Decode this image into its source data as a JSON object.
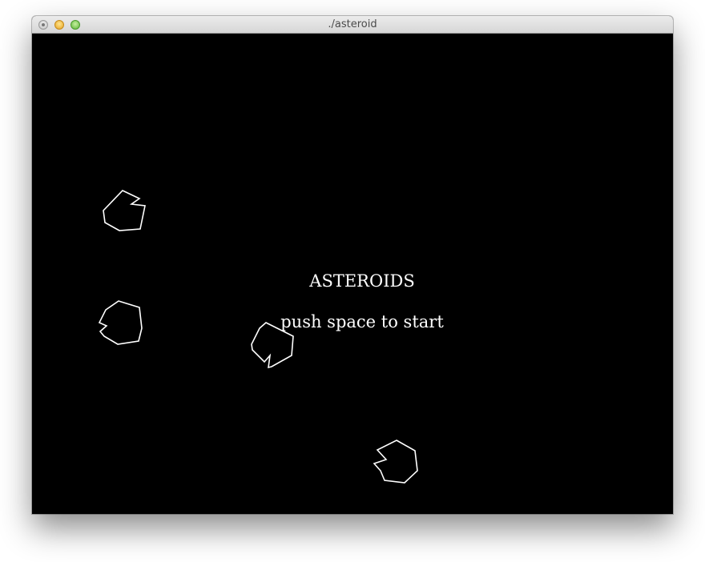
{
  "window": {
    "title": "./asteroid"
  },
  "game": {
    "title": "ASTEROIDS",
    "prompt": "push space to start",
    "colors": {
      "background": "#000000",
      "foreground": "#ffffff"
    },
    "asteroid_count": 4
  }
}
